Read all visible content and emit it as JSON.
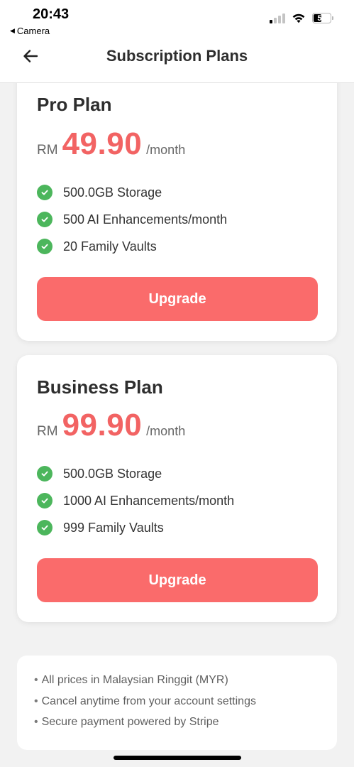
{
  "status_bar": {
    "time": "20:43",
    "back_app": "Camera",
    "back_glyph": "◀",
    "battery_level": "52"
  },
  "header": {
    "title": "Subscription Plans",
    "back_icon": "arrow-left-icon"
  },
  "plans": [
    {
      "name": "Pro Plan",
      "currency": "RM",
      "price": "49.90",
      "period": "/month",
      "features": [
        "500.0GB Storage",
        "500 AI Enhancements/month",
        "20 Family Vaults"
      ],
      "button_label": "Upgrade"
    },
    {
      "name": "Business Plan",
      "currency": "RM",
      "price": "99.90",
      "period": "/month",
      "features": [
        "500.0GB Storage",
        "1000 AI Enhancements/month",
        "999 Family Vaults"
      ],
      "button_label": "Upgrade"
    }
  ],
  "notes": {
    "bullet": "•",
    "items": [
      "All prices in Malaysian Ringgit (MYR)",
      "Cancel anytime from your account settings",
      "Secure payment powered by Stripe"
    ]
  },
  "colors": {
    "accent": "#fa6b6b",
    "price": "#f26363",
    "check": "#4cb65c",
    "background": "#f2f2f2"
  }
}
